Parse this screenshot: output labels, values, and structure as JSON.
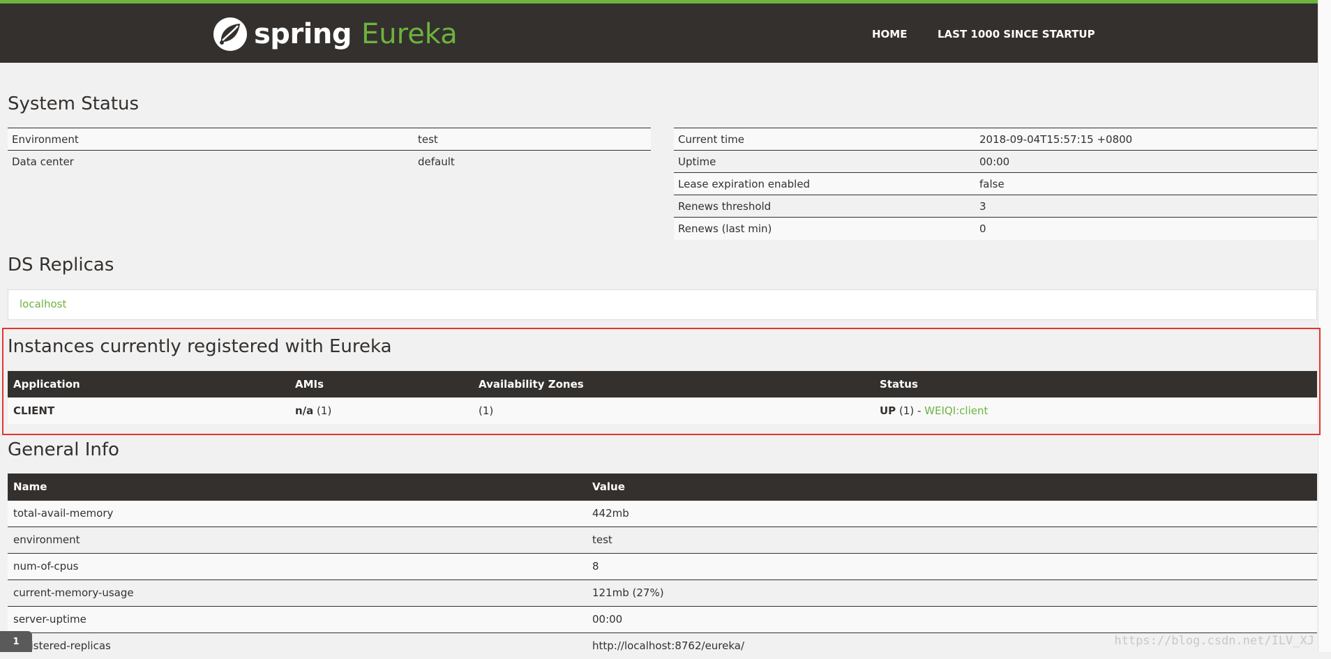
{
  "header": {
    "brand_spring": "spring",
    "brand_eureka": "Eureka",
    "nav": [
      {
        "label": "HOME"
      },
      {
        "label": "LAST 1000 SINCE STARTUP"
      }
    ],
    "colors": {
      "bar": "#34302d",
      "accent": "#6db33f"
    }
  },
  "system_status": {
    "title": "System Status",
    "left": [
      {
        "name": "Environment",
        "value": "test"
      },
      {
        "name": "Data center",
        "value": "default"
      }
    ],
    "right": [
      {
        "name": "Current time",
        "value": "2018-09-04T15:57:15 +0800"
      },
      {
        "name": "Uptime",
        "value": "00:00"
      },
      {
        "name": "Lease expiration enabled",
        "value": "false"
      },
      {
        "name": "Renews threshold",
        "value": "3"
      },
      {
        "name": "Renews (last min)",
        "value": "0"
      }
    ]
  },
  "ds_replicas": {
    "title": "DS Replicas",
    "items": [
      "localhost"
    ]
  },
  "instances": {
    "title": "Instances currently registered with Eureka",
    "columns": [
      "Application",
      "AMIs",
      "Availability Zones",
      "Status"
    ],
    "rows": [
      {
        "application": "CLIENT",
        "amis_bold": "n/a",
        "amis_count": " (1)",
        "zones": "(1)",
        "status_bold": "UP",
        "status_count": " (1) - ",
        "status_link": "WEIQI:client"
      }
    ]
  },
  "general_info": {
    "title": "General Info",
    "columns": [
      "Name",
      "Value"
    ],
    "rows": [
      {
        "name": "total-avail-memory",
        "value": "442mb"
      },
      {
        "name": "environment",
        "value": "test"
      },
      {
        "name": "num-of-cpus",
        "value": "8"
      },
      {
        "name": "current-memory-usage",
        "value": "121mb (27%)"
      },
      {
        "name": "server-uptime",
        "value": "00:00"
      },
      {
        "name": "registered-replicas",
        "value": "http://localhost:8762/eureka/"
      }
    ]
  },
  "overlay": {
    "watermark": "https://blog.csdn.net/ILV_XJ",
    "badge": "1"
  }
}
